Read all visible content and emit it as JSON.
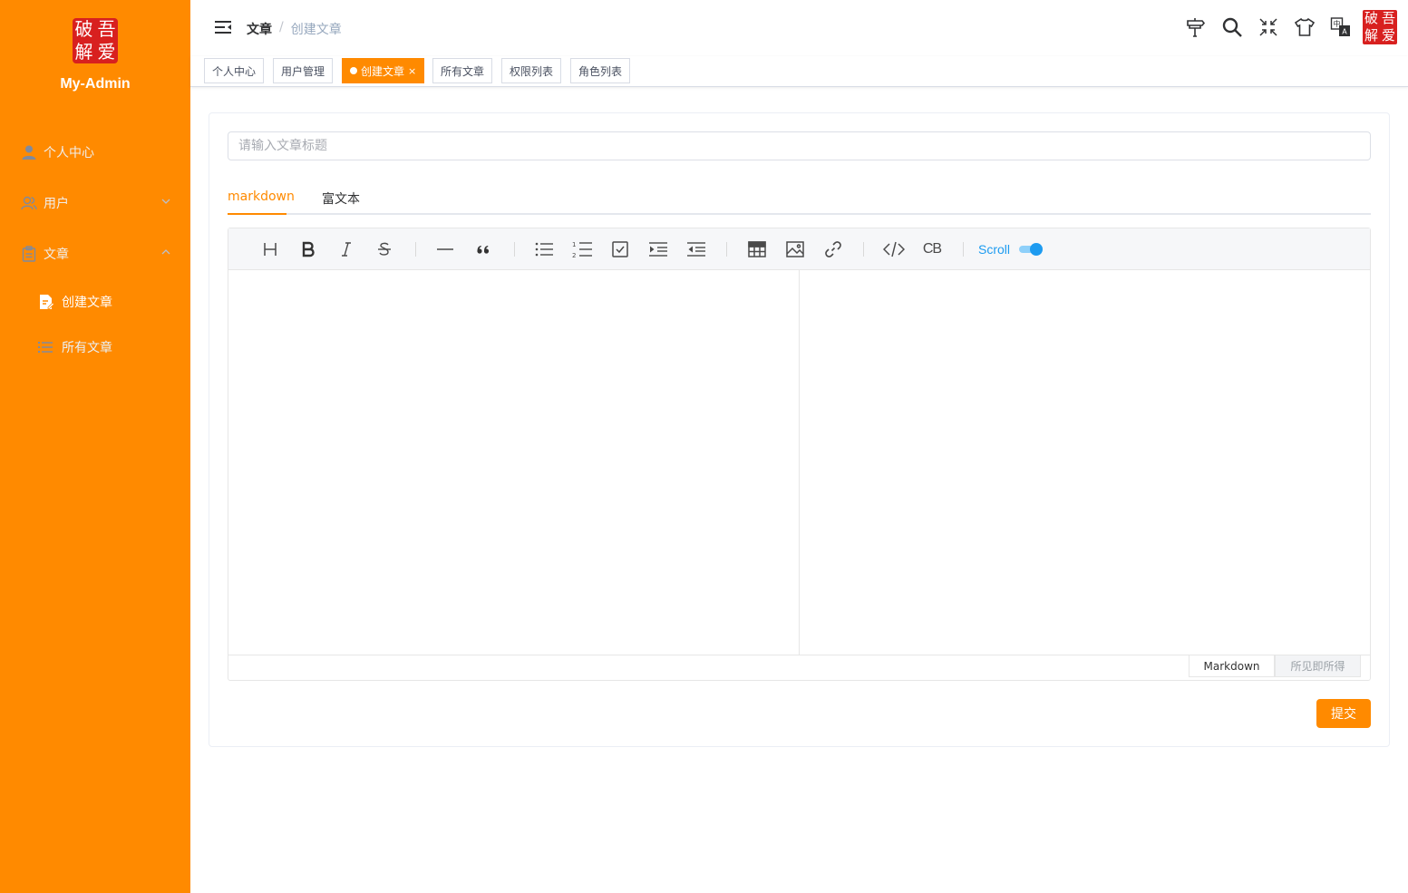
{
  "sidebar": {
    "logo_chars": [
      "破",
      "吾",
      "解",
      "爱"
    ],
    "title": "My-Admin",
    "menu": [
      {
        "label": "个人中心",
        "icon": "user-icon"
      },
      {
        "label": "用户",
        "icon": "users-icon"
      },
      {
        "label": "文章",
        "icon": "clipboard-icon"
      }
    ],
    "submenu": [
      {
        "label": "创建文章",
        "icon": "document-edit-icon"
      },
      {
        "label": "所有文章",
        "icon": "list-icon"
      }
    ]
  },
  "header": {
    "breadcrumb": {
      "parent": "文章",
      "separator": "/",
      "current": "创建文章"
    },
    "icons": [
      "signpost-icon",
      "search-icon",
      "fullscreen-exit-icon",
      "theme-shirt-icon",
      "language-icon"
    ],
    "avatar_chars": [
      "破",
      "吾",
      "解",
      "爱"
    ]
  },
  "tags": [
    {
      "label": "个人中心"
    },
    {
      "label": "用户管理"
    },
    {
      "label": "创建文章",
      "close": "×"
    },
    {
      "label": "所有文章"
    },
    {
      "label": "权限列表"
    },
    {
      "label": "角色列表"
    }
  ],
  "form": {
    "title_placeholder": "请输入文章标题",
    "title_value": "",
    "tabs": [
      "markdown",
      "富文本"
    ],
    "editor": {
      "toolbar_items": [
        "heading-icon",
        "bold-icon",
        "italic-icon",
        "strikethrough-icon",
        "horizontal-rule-icon",
        "quote-icon",
        "bullet-list-icon",
        "ordered-list-icon",
        "task-list-icon",
        "indent-icon",
        "outdent-icon",
        "table-icon",
        "image-icon",
        "link-icon",
        "code-icon",
        "code-block-icon"
      ],
      "code_block_label": "CB",
      "scroll_label": "Scroll",
      "scroll_sync_on": true,
      "mode_markdown": "Markdown",
      "mode_wysiwyg": "所见即所得"
    },
    "submit_label": "提交"
  },
  "colors": {
    "brand": "#ff8a00",
    "seal_red": "#d8201f",
    "scroll_blue": "#1d9bf0"
  }
}
